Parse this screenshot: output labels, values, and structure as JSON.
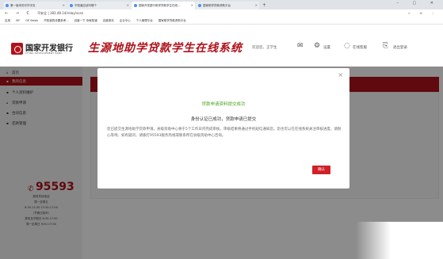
{
  "browser": {
    "tabs": [
      {
        "label": "第一版本的中华字页",
        "active": false
      },
      {
        "label": "不知道应该叫哪个",
        "active": false
      },
      {
        "label": "国家开发银行助学贷款学生在线...",
        "active": true
      },
      {
        "label": "国家助学贷款资助平台",
        "active": false
      }
    ],
    "new_tab": "+",
    "window_controls": "– ▢ ✕",
    "nav_buttons": "← → C",
    "url": "不安全 | 183.48.14/relay/scan",
    "right_tools": "☆ ⊙ ⋮",
    "bookmarks": [
      "应用",
      "SIF",
      "GE Baidu",
      "不知道的设置参考...",
      "百度一下 你就知道",
      "百度首页",
      "企业中心",
      "个人管理平台",
      "国家助学贷款资助平台"
    ]
  },
  "header": {
    "bank_name": "国家开发银行",
    "bank_name_en": "CHINA DEVELOPMENT BANK",
    "site_title": "生源地助学贷款学生在线系统",
    "greeting": "欢迎您，王学生",
    "mail_icon": "✉",
    "settings_icon": "⚙",
    "settings_label": "设置",
    "online_help_icon": "◌",
    "online_help_label": "在线客服",
    "logout_icon": "⎘",
    "logout_label": "退出登录"
  },
  "sidebar": {
    "items": [
      {
        "icon": "⌂",
        "label": "首页",
        "active": false
      },
      {
        "icon": "▪",
        "label": "我的信息",
        "active": true
      },
      {
        "icon": "▪",
        "label": "个人资料维护",
        "active": false
      },
      {
        "icon": "▴",
        "label": "贷款申请",
        "active": false
      },
      {
        "icon": "▪",
        "label": "合同信息",
        "active": false
      },
      {
        "icon": "▪",
        "label": "还款管理",
        "active": false
      }
    ],
    "hotline": "95593",
    "service_lines": [
      "服务热线电话",
      "周一至周五",
      "8:30-11:30  13:30-17:00",
      "（节假日除外）",
      "周末及节假日 8:30-17:00",
      "周一至周日 9:00-17:00"
    ]
  },
  "modal": {
    "close": "×",
    "title": "贷款申请资料提交成功",
    "subtitle": "身份认证已成功，贷款申请已提交",
    "body": "您已提交生源地助学贷款申请。县级资助中心将于5个工作日内完成审核，审核结果将通过手机短信通知您。您也可以在在线系统关注审核进度，请耐心等待。如有疑问，请拨打95593服务热线或联系所在县级资助中心咨询。",
    "ok_label": "确认"
  }
}
